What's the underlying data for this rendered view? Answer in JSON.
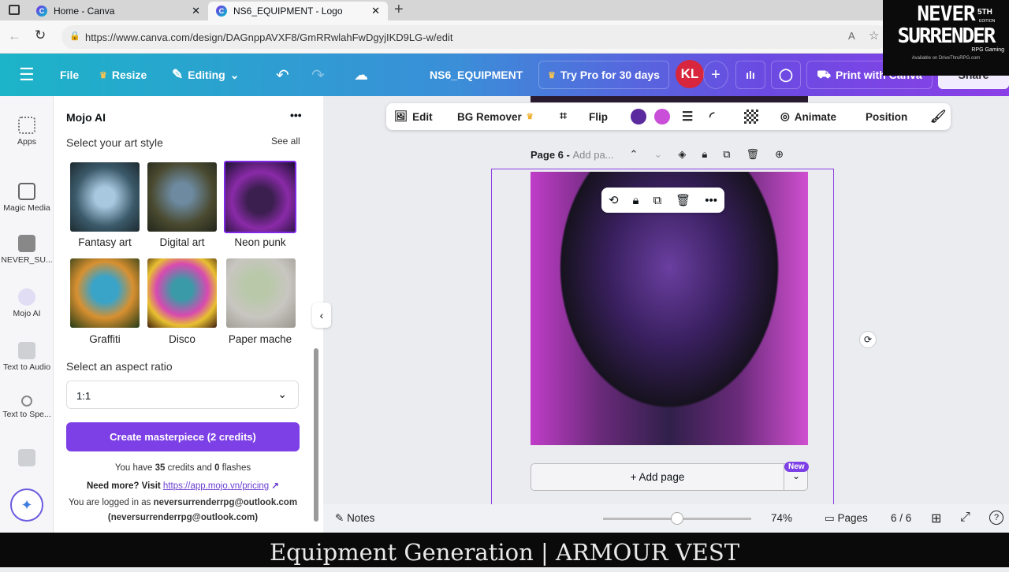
{
  "browser": {
    "tabs": [
      {
        "title": "Home - Canva"
      },
      {
        "title": "NS6_EQUIPMENT - Logo"
      }
    ],
    "url": "https://www.canva.com/design/DAGnppAVXF8/GmRRwlahFwDgyjIKD9LG-w/edit"
  },
  "header": {
    "file": "File",
    "resize": "Resize",
    "editing": "Editing",
    "doc_title": "NS6_EQUIPMENT",
    "try_pro": "Try Pro for 30 days",
    "avatar": "KL",
    "print": "Print with Canva",
    "share": "Share"
  },
  "watermark": {
    "line1": "NEVER",
    "edition": "5TH",
    "edition_sub": "EDITION",
    "line2": "SURRENDER",
    "tag": "RPG Gaming",
    "avail": "Available on DriveThruRPG.com"
  },
  "rail": [
    {
      "label": "Apps"
    },
    {
      "label": "Magic Media"
    },
    {
      "label": "NEVER_SU..."
    },
    {
      "label": "Mojo AI"
    },
    {
      "label": "Text to Audio"
    },
    {
      "label": "Text to Spe..."
    }
  ],
  "panel": {
    "title": "Mojo AI",
    "more": "•••",
    "style_heading": "Select your art style",
    "see_all": "See all",
    "styles": [
      {
        "label": "Fantasy art"
      },
      {
        "label": "Digital art"
      },
      {
        "label": "Neon punk"
      },
      {
        "label": "Graffiti"
      },
      {
        "label": "Disco"
      },
      {
        "label": "Paper mache"
      }
    ],
    "selected_style": "Neon punk",
    "aspect_heading": "Select an aspect ratio",
    "aspect_value": "1:1",
    "create_button": "Create masterpiece (2 credits)",
    "credits_pre": "You have ",
    "credits": "35",
    "credits_mid": " credits and ",
    "flashes": "0",
    "credits_post": " flashes",
    "need_more": "Need more? Visit ",
    "pricing_link": "https://app.mojo.vn/pricing",
    "logged_pre": "You are logged in as ",
    "email": "neversurrenderrpg@outlook.com",
    "email_paren": "(neversurrenderrpg@outlook.com)"
  },
  "toolbar": {
    "edit": "Edit",
    "bg_remover": "BG Remover",
    "flip": "Flip",
    "animate": "Animate",
    "position": "Position",
    "colors": [
      "#5b2a9e",
      "#c94fd8"
    ]
  },
  "page": {
    "label": "Page 6 - ",
    "placeholder": "Add pa...",
    "add_page": "+ Add page",
    "new_badge": "New"
  },
  "bottom": {
    "notes": "Notes",
    "zoom": "74%",
    "zoom_fraction": 0.5,
    "pages": "Pages",
    "page_count": "6 / 6"
  },
  "caption": "Equipment Generation | ARMOUR VEST"
}
